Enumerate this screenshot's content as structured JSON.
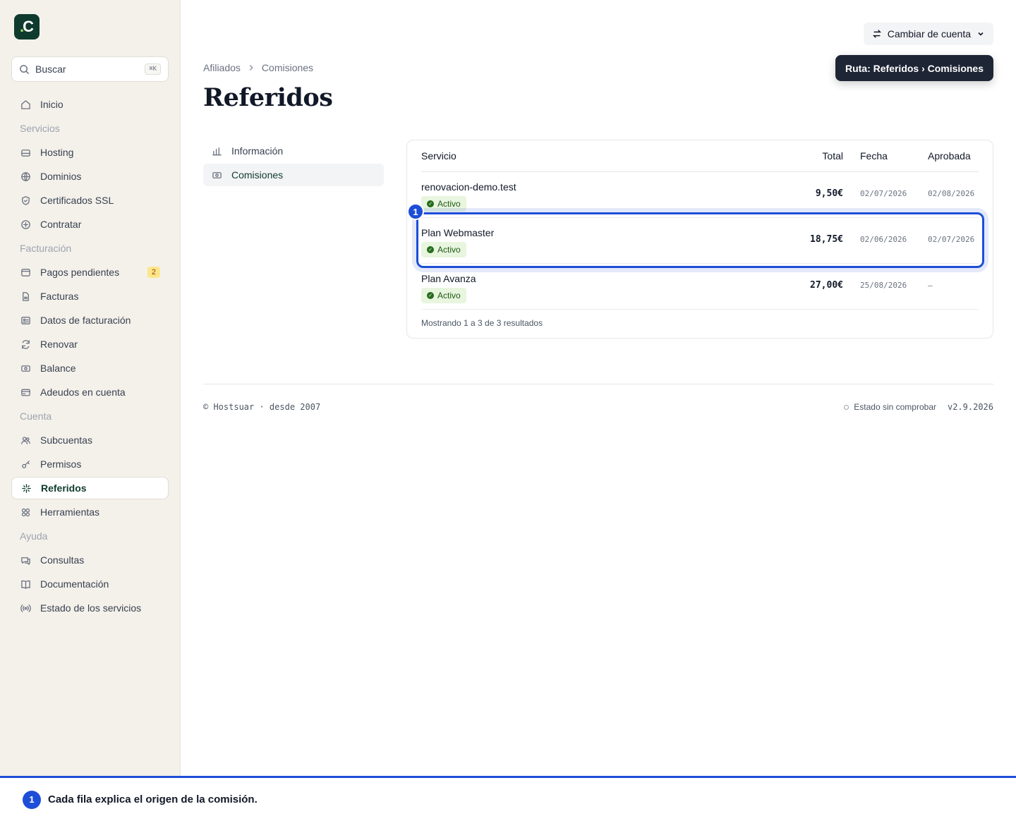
{
  "logo": {
    "letter": "C",
    "dot": "."
  },
  "search": {
    "placeholder": "Buscar",
    "shortcut": "⌘K"
  },
  "sidebar": [
    {
      "type": "item",
      "label": "Inicio",
      "icon": "home-icon"
    },
    {
      "type": "section",
      "label": "Servicios"
    },
    {
      "type": "item",
      "label": "Hosting",
      "icon": "server-icon"
    },
    {
      "type": "item",
      "label": "Dominios",
      "icon": "globe-icon"
    },
    {
      "type": "item",
      "label": "Certificados SSL",
      "icon": "shield-icon"
    },
    {
      "type": "item",
      "label": "Contratar",
      "icon": "plus-circle-icon"
    },
    {
      "type": "section",
      "label": "Facturación"
    },
    {
      "type": "item",
      "label": "Pagos pendientes",
      "icon": "wallet-icon",
      "badge": "2"
    },
    {
      "type": "item",
      "label": "Facturas",
      "icon": "file-icon"
    },
    {
      "type": "item",
      "label": "Datos de facturación",
      "icon": "id-card-icon"
    },
    {
      "type": "item",
      "label": "Renovar",
      "icon": "refresh-icon"
    },
    {
      "type": "item",
      "label": "Balance",
      "icon": "banknote-icon"
    },
    {
      "type": "item",
      "label": "Adeudos en cuenta",
      "icon": "credit-card-icon"
    },
    {
      "type": "section",
      "label": "Cuenta"
    },
    {
      "type": "item",
      "label": "Subcuentas",
      "icon": "users-icon"
    },
    {
      "type": "item",
      "label": "Permisos",
      "icon": "key-icon"
    },
    {
      "type": "item",
      "label": "Referidos",
      "icon": "sparkles-icon",
      "active": true
    },
    {
      "type": "item",
      "label": "Herramientas",
      "icon": "grid-icon"
    },
    {
      "type": "section",
      "label": "Ayuda"
    },
    {
      "type": "item",
      "label": "Consultas",
      "icon": "chat-icon"
    },
    {
      "type": "item",
      "label": "Documentación",
      "icon": "book-icon"
    },
    {
      "type": "item",
      "label": "Estado de los servicios",
      "icon": "broadcast-icon"
    }
  ],
  "header": {
    "switch_account": "Cambiar de cuenta",
    "tooltip": "Ruta: Referidos › Comisiones"
  },
  "breadcrumb": [
    "Afiliados",
    "Comisiones"
  ],
  "page_title": "Referidos",
  "subnav": [
    {
      "label": "Información",
      "icon": "chart-icon"
    },
    {
      "label": "Comisiones",
      "icon": "banknote-icon",
      "active": true
    }
  ],
  "table": {
    "columns": {
      "servicio": "Servicio",
      "total": "Total",
      "fecha": "Fecha",
      "aprobada": "Aprobada"
    },
    "rows": [
      {
        "servicio": "renovacion-demo.test",
        "estado": "Activo",
        "total": "9,50€",
        "fecha": "02/07/2026",
        "aprobada": "02/08/2026"
      },
      {
        "servicio": "Plan Webmaster",
        "estado": "Activo",
        "total": "18,75€",
        "fecha": "02/06/2026",
        "aprobada": "02/07/2026"
      },
      {
        "servicio": "Plan Avanza",
        "estado": "Activo",
        "total": "27,00€",
        "fecha": "25/08/2026",
        "aprobada": "—"
      }
    ],
    "footer": "Mostrando 1 a 3 de 3 resultados"
  },
  "annotation": {
    "number": "1",
    "text": "Cada fila explica el origen de la comisión."
  },
  "footer": {
    "copyright": "© Hostsuar · desde 2007",
    "status": "Estado sin comprobar",
    "version": "v2.9.2026"
  },
  "colors": {
    "brand": "#0f3b2e",
    "accent": "#1d4ed8",
    "badge": "#fde68a",
    "active_pill": "#e8f5df"
  }
}
